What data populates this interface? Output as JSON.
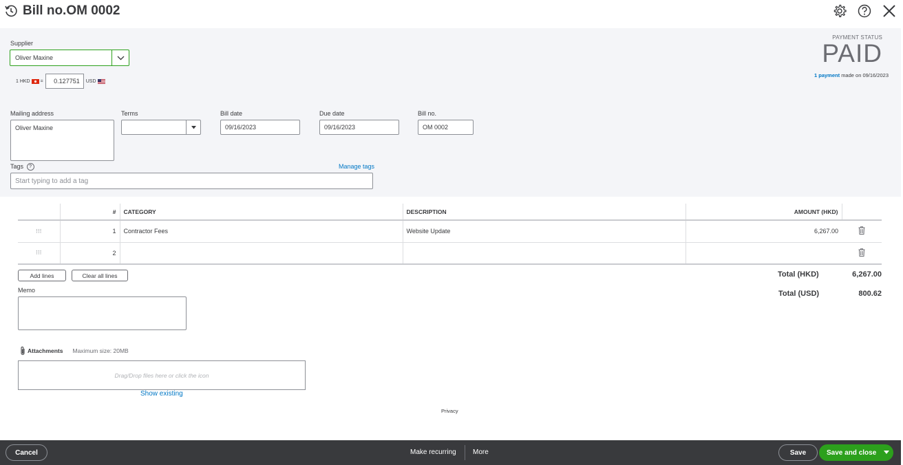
{
  "header": {
    "title": "Bill no.OM 0002"
  },
  "form": {
    "supplier_label": "Supplier",
    "supplier_value": "Oliver Maxine",
    "fx_from": "1 HKD",
    "fx_eq": "=",
    "fx_rate": "0.127751",
    "fx_to": "USD",
    "payment_status_label": "PAYMENT STATUS",
    "payment_status": "PAID",
    "payment_link": "1 payment",
    "payment_made_on": "made on 09/16/2023",
    "mailing_label": "Mailing address",
    "mailing_value": "Oliver Maxine",
    "terms_label": "Terms",
    "terms_value": "",
    "bill_date_label": "Bill date",
    "bill_date": "09/16/2023",
    "due_date_label": "Due date",
    "due_date": "09/16/2023",
    "bill_no_label": "Bill no.",
    "bill_no": "OM 0002",
    "tags_label": "Tags",
    "manage_tags": "Manage tags",
    "tags_placeholder": "Start typing to add a tag"
  },
  "table": {
    "headers": [
      "#",
      "CATEGORY",
      "DESCRIPTION",
      "AMOUNT (HKD)"
    ],
    "rows": [
      {
        "num": "1",
        "category": "Contractor Fees",
        "description": "Website Update",
        "amount": "6,267.00"
      },
      {
        "num": "2",
        "category": "",
        "description": "",
        "amount": ""
      }
    ],
    "add_lines": "Add lines",
    "clear_lines": "Clear all lines"
  },
  "totals": {
    "hkd_label": "Total (HKD)",
    "hkd_value": "6,267.00",
    "usd_label": "Total (USD)",
    "usd_value": "800.62"
  },
  "memo_label": "Memo",
  "attachments": {
    "label": "Attachments",
    "max_size": "Maximum size: 20MB",
    "dropzone": "Drag/Drop files here or click the icon",
    "show_existing": "Show existing"
  },
  "privacy": "Privacy",
  "footer": {
    "cancel": "Cancel",
    "make_recurring": "Make recurring",
    "more": "More",
    "save": "Save",
    "save_and_close": "Save and close"
  },
  "colors": {
    "accent_green": "#2ca01c",
    "link_blue": "#0077c5",
    "footer_bg": "#393a3d"
  }
}
